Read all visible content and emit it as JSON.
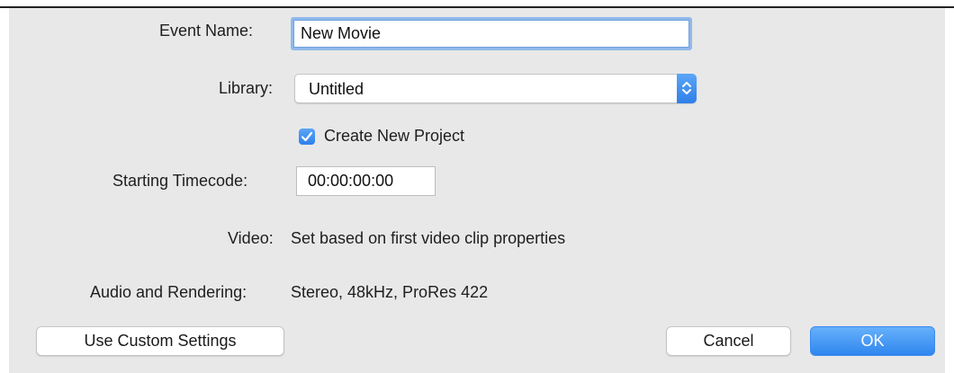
{
  "dialog": {
    "event_name_label": "Event Name:",
    "event_name_value": "New Movie",
    "library_label": "Library:",
    "library_value": "Untitled",
    "create_project_label": "Create New Project",
    "create_project_checked": true,
    "timecode_label": "Starting Timecode:",
    "timecode_value": "00:00:00:00",
    "video_label": "Video:",
    "video_value": "Set based on first video clip properties",
    "audio_label": "Audio and Rendering:",
    "audio_value": "Stereo, 48kHz, ProRes 422"
  },
  "buttons": {
    "custom_settings": "Use Custom Settings",
    "cancel": "Cancel",
    "ok": "OK"
  },
  "colors": {
    "accent": "#2f86ee",
    "sheet_background": "#e8e8e8",
    "focus_ring": "#8fb9ec"
  },
  "icons": {
    "library_stepper": "chevron-up-down-icon",
    "checkbox": "checkmark-icon"
  }
}
